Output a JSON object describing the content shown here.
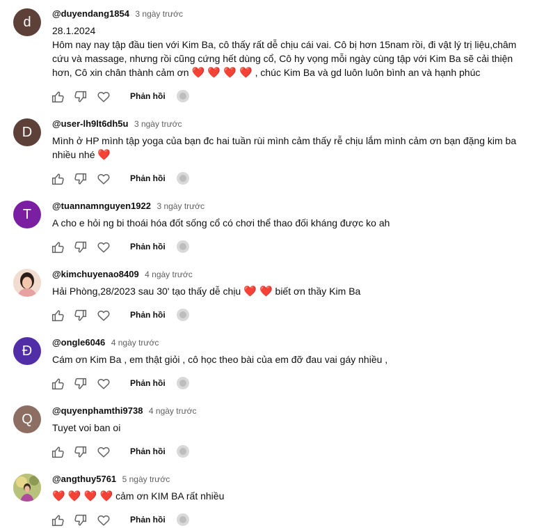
{
  "labels": {
    "reply": "Phản hồi"
  },
  "colors": {
    "heart": "#e01b24",
    "muted": "#606060"
  },
  "icons": [
    "thumbs-up-icon",
    "thumbs-down-icon",
    "heart-icon",
    "creator-heart-icon"
  ],
  "comments": [
    {
      "author": "@duyendang1854",
      "time": "3 ngày trước",
      "avatar_letter": "d",
      "avatar_color": "#5d4037",
      "date_line": "28.1.2024",
      "text": "Hôm nay nay tập đầu tien với Kim Ba, cô thấy rất dễ chịu cái vai. Cô bị hơn 15nam rồi, đi vật lý trị liệu,châm cứu và massage, nhưng rồi cũng cứng hết dùng cổ, Cô hy vọng mỗi ngày cùng tập với Kim Ba sẽ cải thiện hơn, Cô xin chân thành cảm ơn",
      "hearts": "❤️ ❤️ ❤️ ❤️",
      "text_after": ", chúc Kim Ba và gd luôn luôn bình an và hạnh phúc"
    },
    {
      "author": "@user-lh9lt6dh5u",
      "time": "3 ngày trước",
      "avatar_letter": "D",
      "avatar_color": "#5d4037",
      "text": "Mình ở HP mình tập yoga của bạn đc hai tuần rùi mình cảm thấy rễ chịu lắm mình cảm ơn bạn đặng kim ba nhiều nhé",
      "hearts": "❤️"
    },
    {
      "author": "@tuannamnguyen1922",
      "time": "3 ngày trước",
      "avatar_letter": "T",
      "avatar_color": "#7b1fa2",
      "text": "A cho e hỏi ng bi thoái hóa đốt sống cổ có chơi thể thao đối kháng được ko ah"
    },
    {
      "author": "@kimchuyenao8409",
      "time": "4 ngày trước",
      "avatar_letter": "",
      "avatar_color": "#f3d7c8",
      "text": "Hải Phòng,28/2023 sau 30' tạo thấy dễ chịu",
      "hearts": "❤️ ❤️",
      "text_after": "biết ơn thầy Kim Ba"
    },
    {
      "author": "@ongle6046",
      "time": "4 ngày trước",
      "avatar_letter": "Đ",
      "avatar_color": "#512da8",
      "text": "Cám ơn Kim Ba , em thật giỏi , cô học theo bài của em đỡ đau vai gáy nhiều ,"
    },
    {
      "author": "@quyenphamthi9738",
      "time": "4 ngày trước",
      "avatar_letter": "Q",
      "avatar_color": "#8d6e63",
      "text": "Tuyet voi ban oi"
    },
    {
      "author": "@angthuy5761",
      "time": "5 ngày trước",
      "avatar_letter": "",
      "avatar_color": "#c9b68a",
      "hearts": "❤️ ❤️ ❤️ ❤️",
      "text_after": "cảm ơn KIM BA rất nhiều"
    }
  ]
}
